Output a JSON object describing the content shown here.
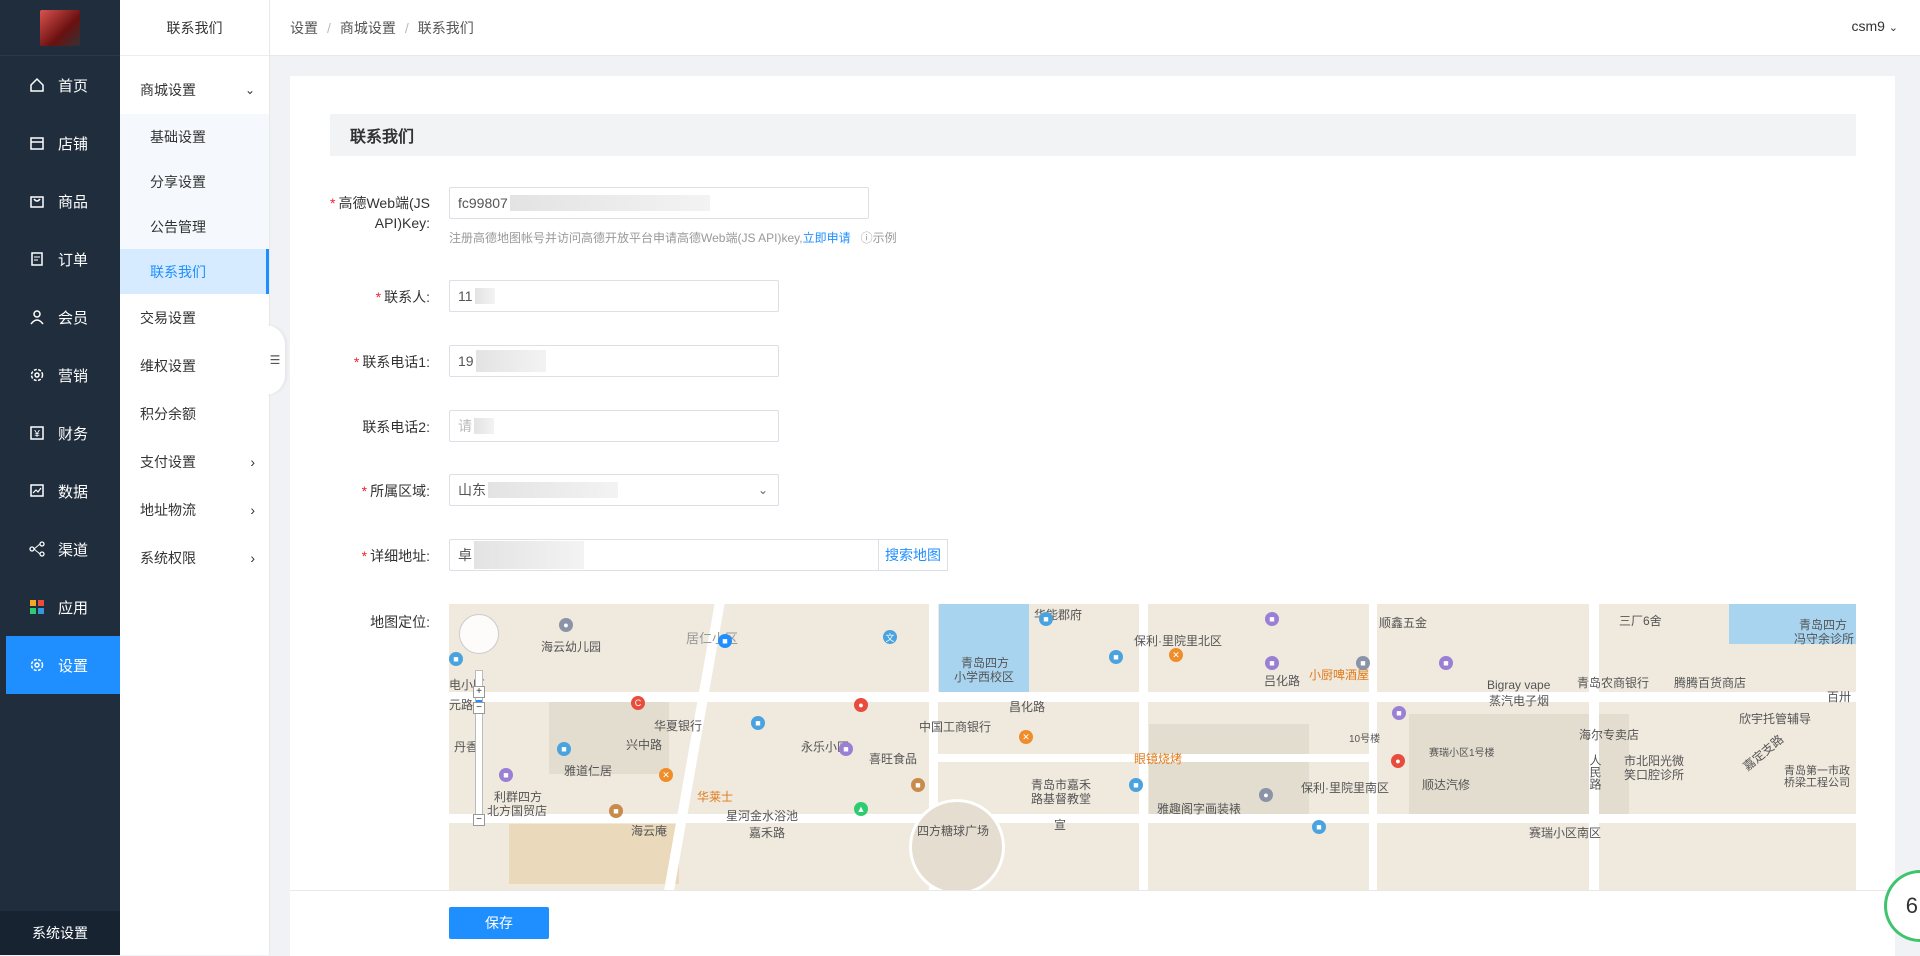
{
  "nav": {
    "items": [
      {
        "label": "首页",
        "icon": "home-icon"
      },
      {
        "label": "店铺",
        "icon": "store-icon"
      },
      {
        "label": "商品",
        "icon": "bag-icon"
      },
      {
        "label": "订单",
        "icon": "order-icon"
      },
      {
        "label": "会员",
        "icon": "user-icon"
      },
      {
        "label": "营销",
        "icon": "gear-marketing-icon"
      },
      {
        "label": "财务",
        "icon": "yen-icon"
      },
      {
        "label": "数据",
        "icon": "chart-icon"
      },
      {
        "label": "渠道",
        "icon": "share-icon"
      },
      {
        "label": "应用",
        "icon": "apps-icon"
      },
      {
        "label": "设置",
        "icon": "settings-icon"
      }
    ],
    "footer": "系统设置",
    "active": "设置"
  },
  "submenu": {
    "title": "联系我们",
    "groups": [
      {
        "label": "商城设置",
        "children": [
          "基础设置",
          "分享设置",
          "公告管理",
          "联系我们"
        ]
      },
      {
        "label": "交易设置"
      },
      {
        "label": "维权设置"
      },
      {
        "label": "积分余额"
      },
      {
        "label": "支付设置"
      },
      {
        "label": "地址物流"
      },
      {
        "label": "系统权限"
      }
    ],
    "active": "联系我们"
  },
  "breadcrumb": [
    "设置",
    "商城设置",
    "联系我们"
  ],
  "user": "csm9",
  "form": {
    "section_title": "联系我们",
    "amap_label_1": "高德Web端(JS",
    "amap_label_2": "API)Key:",
    "amap_value": "fc99807",
    "amap_hint": "注册高德地图帐号并访问高德开放平台申请高德Web端(JS API)key,",
    "amap_apply": "立即申请",
    "amap_example": "示例",
    "contact_label": "联系人:",
    "contact_value": "11",
    "phone1_label": "联系电话1:",
    "phone1_value": "19",
    "phone2_label": "联系电话2:",
    "phone2_value": "请",
    "region_label": "所属区域:",
    "region_value": "山东",
    "address_label": "详细地址:",
    "address_value": "卓",
    "search_map": "搜索地图",
    "map_label": "地图定位:",
    "save": "保存"
  },
  "map": {
    "labels": [
      "海云幼儿园",
      "居仁小区",
      "华能郡府",
      "青岛四方",
      "小学西校区",
      "保利·里院里北区",
      "顺鑫五金",
      "三厂6舍",
      "青岛四方",
      "冯守余诊所",
      "电小区",
      "昌化路",
      "吕化路",
      "小厨啤酒屋",
      "Bigray vape",
      "蒸汽电子烟",
      "青岛农商银行",
      "腾腾百货商店",
      "百卅",
      "华夏银行",
      "中国工商银行",
      "永乐小区",
      "欣宇托管辅导",
      "元路",
      "丹香",
      "兴中路",
      "海尔专卖店",
      "雅道仁居",
      "喜旺食品",
      "眼镜烧烤",
      "10号楼",
      "青岛第一市政",
      "桥梁工程公司",
      "利群四方",
      "北方国贸店",
      "华莱士",
      "青岛市嘉禾",
      "路基督教堂",
      "保利·里院里南区",
      "顺达汽修",
      "市北阳光微",
      "笑口腔诊所",
      "嘉定支路",
      "人民路",
      "星河金水浴池",
      "海云庵",
      "四方糖球广场",
      "雅趣阁字画装裱",
      "赛瑞小区南区",
      "赛瑞小区1号楼",
      "宣",
      "嘉禾路"
    ]
  },
  "badge": "6"
}
